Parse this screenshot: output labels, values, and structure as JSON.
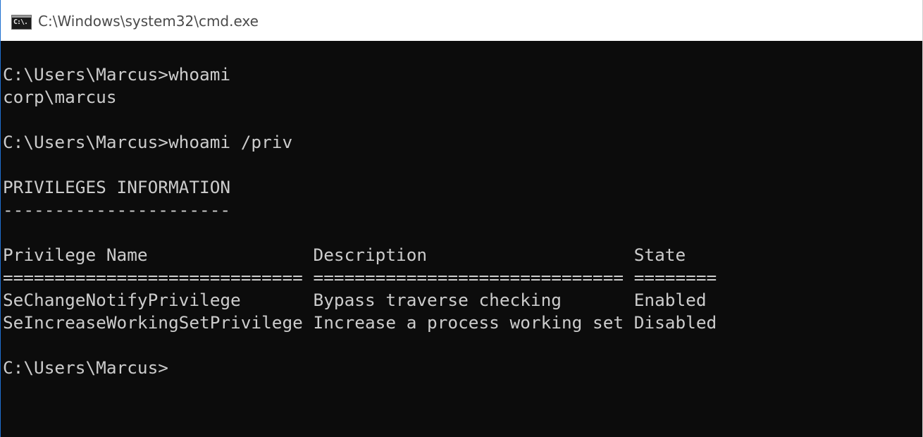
{
  "window": {
    "title": "C:\\Windows\\system32\\cmd.exe",
    "icon": "cmd-console-icon",
    "icon_glyph": "C:\\."
  },
  "console": {
    "lines": [
      "C:\\Users\\Marcus>whoami",
      "corp\\marcus",
      "",
      "C:\\Users\\Marcus>whoami /priv",
      "",
      "PRIVILEGES INFORMATION",
      "----------------------",
      "",
      "Privilege Name                Description                    State",
      "============================= ============================== ========",
      "SeChangeNotifyPrivilege       Bypass traverse checking       Enabled",
      "SeIncreaseWorkingSetPrivilege Increase a process working set Disabled",
      "",
      "C:\\Users\\Marcus>"
    ]
  },
  "colors": {
    "background": "#0c0c0c",
    "foreground": "#cccccc",
    "titlebar": "#ffffff",
    "accent_border": "#1e6fd0"
  }
}
